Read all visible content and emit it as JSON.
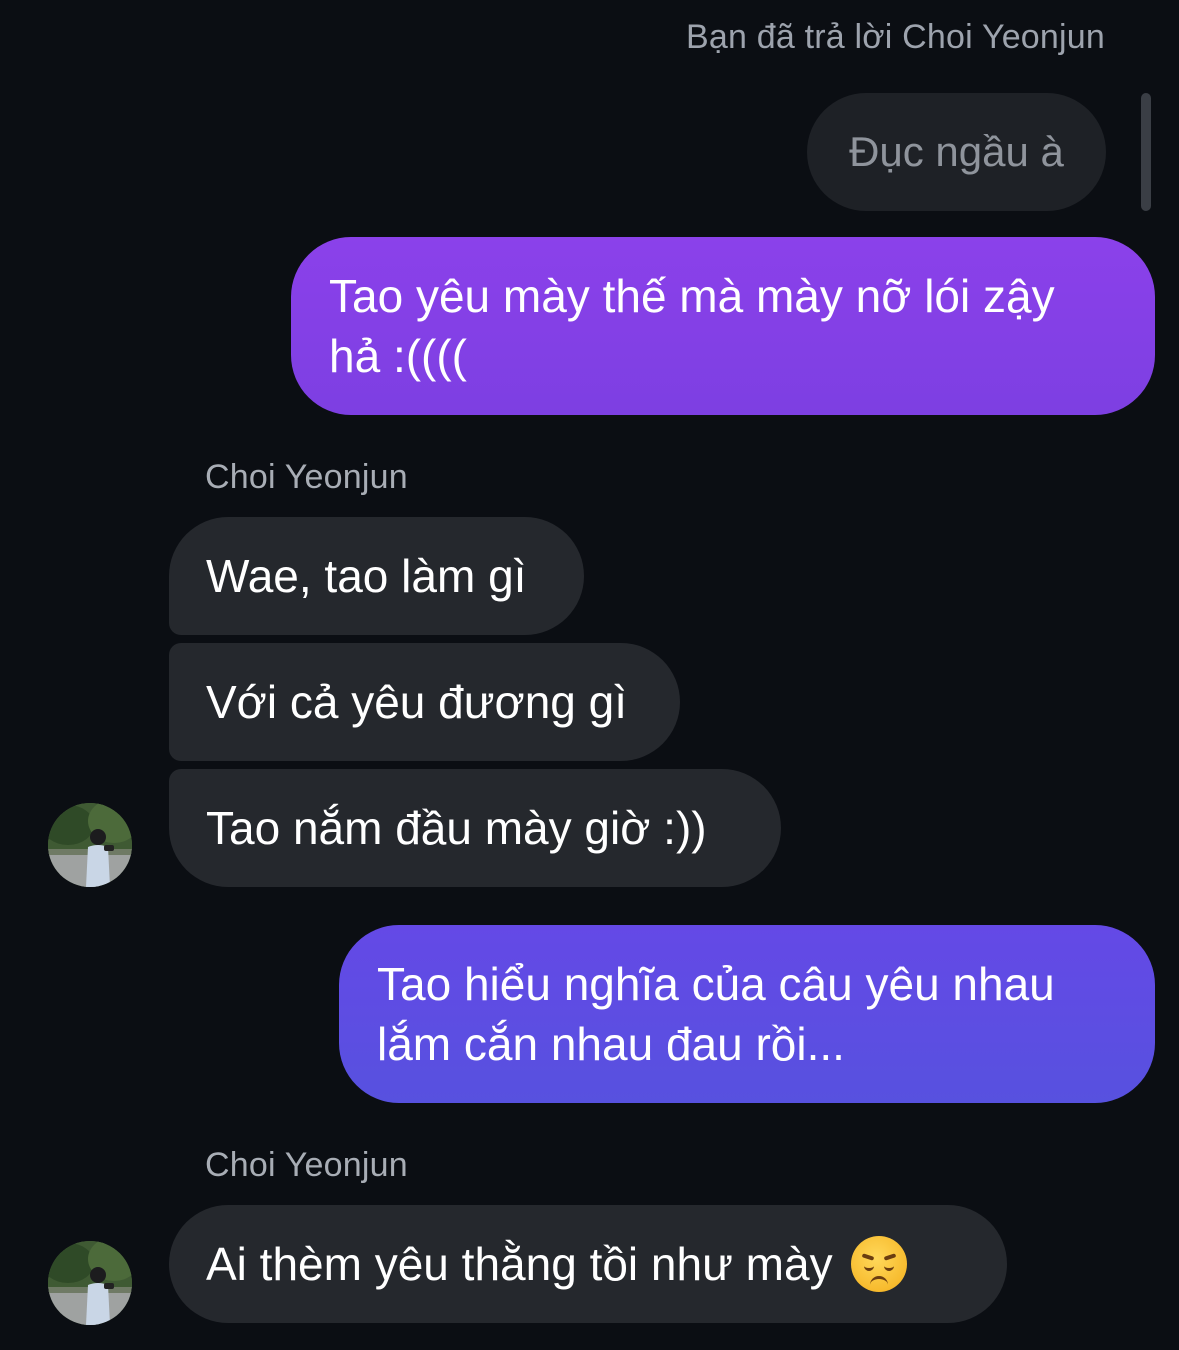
{
  "thread": {
    "reply_context": "Bạn đã trả lời Choi Yeonjun",
    "quoted_message": "Đục ngầu à"
  },
  "messages": {
    "outgoing_1": "Tao yêu mày thế mà mày nỡ lói zậy hả :((((",
    "sender_1": "Choi Yeonjun",
    "incoming_1": "Wae, tao làm gì",
    "incoming_2": "Với cả yêu đương gì",
    "incoming_3": "Tao nắm đầu mày giờ :))",
    "outgoing_2": "Tao hiểu nghĩa của câu yêu nhau lắm cắn nhau đau rồi...",
    "sender_2": "Choi Yeonjun",
    "incoming_4": "Ai thèm yêu thằng tồi như mày",
    "incoming_4_emoji": "disappointed-face-icon"
  },
  "colors": {
    "background": "#0b0e13",
    "incoming_bubble": "#25282d",
    "outgoing_bubble_top": "#8b41ea",
    "outgoing_bubble_bottom": "#5751df",
    "secondary_text": "#9da3ad"
  }
}
